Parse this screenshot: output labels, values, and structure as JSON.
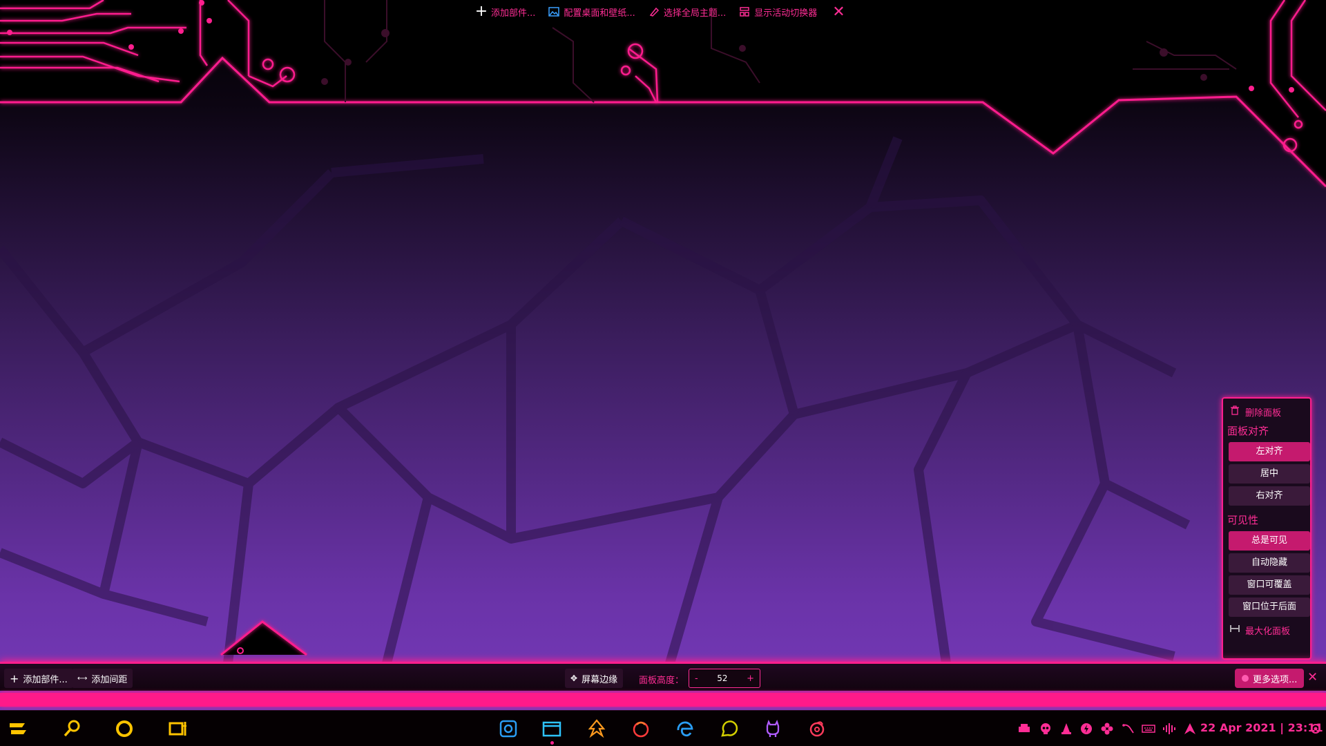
{
  "desktop_toolbox": {
    "add_widgets": "添加部件...",
    "configure_desktop": "配置桌面和壁纸...",
    "global_theme": "选择全局主题...",
    "activity_switcher": "显示活动切换器"
  },
  "panel_popup": {
    "remove_panel": "删除面板",
    "alignment_title": "面板对齐",
    "alignment_options": [
      "左对齐",
      "居中",
      "右对齐"
    ],
    "alignment_selected": "左对齐",
    "visibility_title": "可见性",
    "visibility_options": [
      "总是可见",
      "自动隐藏",
      "窗口可覆盖",
      "窗口位于后面"
    ],
    "visibility_selected": "总是可见",
    "maximize_panel": "最大化面板"
  },
  "panel_editbar": {
    "add_widgets": "添加部件...",
    "add_spacer": "添加间距",
    "screen_edge": "屏幕边缘",
    "panel_height_label": "面板高度：",
    "panel_height_value": "52",
    "decrement": "-",
    "increment": "+",
    "more_options": "更多选项..."
  },
  "taskbar": {
    "clock": "22 Apr 2021 | 23:11",
    "launchers": [
      "menu-launcher-icon",
      "search-icon",
      "circle-launcher-icon",
      "window-switch-icon"
    ],
    "tasks": [
      "screenshot-app-icon",
      "file-manager-icon",
      "inkscape-icon",
      "firefox-icon",
      "edge-browser-icon",
      "chat-app-icon",
      "github-icon",
      "music-player-icon"
    ],
    "tray": [
      "printer-icon",
      "skull-icon",
      "wizard-icon",
      "power-icon",
      "flower-icon",
      "network-icon",
      "keyboard-icon",
      "audio-icon",
      "arch-icon",
      "notifications-icon"
    ]
  },
  "colors": {
    "accent": "#ff1f8e",
    "accent_text": "#ff2d95",
    "launcher_yellow": "#ffc400"
  }
}
